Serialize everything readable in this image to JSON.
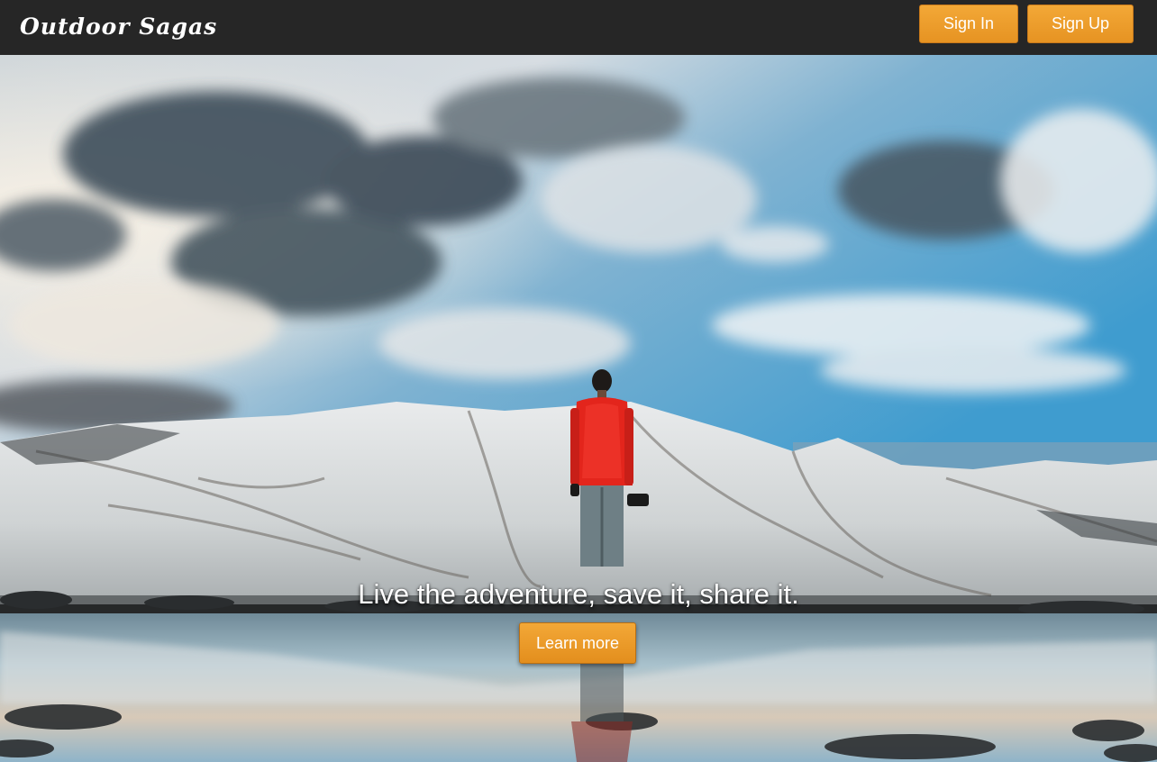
{
  "navbar": {
    "brand": "Outdoor Sagas",
    "signin_label": "Sign In",
    "signup_label": "Sign Up"
  },
  "hero": {
    "tagline": "Live the adventure, save it, share it.",
    "cta_label": "Learn more"
  },
  "colors": {
    "navbar_bg": "#262626",
    "accent": "#f0a030",
    "jacket": "#e3251c"
  }
}
